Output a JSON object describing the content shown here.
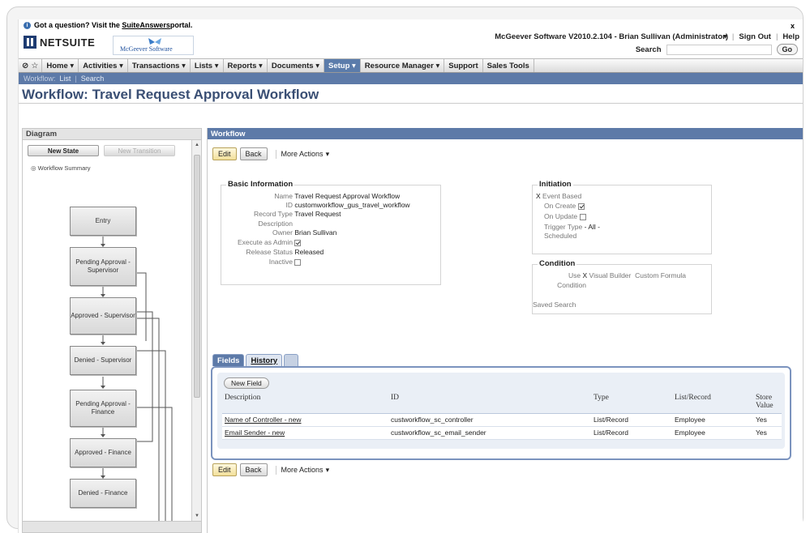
{
  "banner": {
    "question_prefix": "Got a question? Visit the ",
    "question_link": "SuiteAnswers",
    "question_suffix": " portal.",
    "close": "x"
  },
  "header": {
    "netsuite_logo": "NETSUITE",
    "company_logo_text": "McGeever Software",
    "user_info": "McGeever Software V2010.2.104 - Brian Sullivan (Administrator)",
    "sign_out": "Sign Out",
    "help": "Help",
    "search_label": "Search",
    "go": "Go"
  },
  "nav": {
    "items": [
      {
        "label": "Home"
      },
      {
        "label": "Activities"
      },
      {
        "label": "Transactions"
      },
      {
        "label": "Lists"
      },
      {
        "label": "Reports"
      },
      {
        "label": "Documents"
      },
      {
        "label": "Setup"
      },
      {
        "label": "Resource Manager"
      },
      {
        "label": "Support"
      },
      {
        "label": "Sales Tools"
      }
    ]
  },
  "subnav": {
    "prefix": "Workflow:",
    "list": "List",
    "search": "Search"
  },
  "page": {
    "title": "Workflow: Travel Request Approval Workflow"
  },
  "diagram": {
    "header": "Diagram",
    "new_state": "New State",
    "new_transition": "New Transition",
    "summary": "Workflow Summary",
    "states": [
      "Entry",
      "Pending Approval - Supervisor",
      "Approved - Supervisor",
      "Denied - Supervisor",
      "Pending Approval - Finance",
      "Approved - Finance",
      "Denied - Finance"
    ]
  },
  "workflow": {
    "header": "Workflow",
    "edit": "Edit",
    "back": "Back",
    "more_actions": "More Actions",
    "basic_info": {
      "title": "Basic Information",
      "name_label": "Name",
      "name": "Travel Request Approval Workflow",
      "id_label": "ID",
      "id": "customworkflow_gus_travel_workflow",
      "record_type_label": "Record Type",
      "record_type": "Travel Request",
      "description_label": "Description",
      "owner_label": "Owner",
      "owner": "Brian Sullivan",
      "execute_admin_label": "Execute as Admin",
      "release_status_label": "Release Status",
      "release_status": "Released",
      "inactive_label": "Inactive"
    },
    "initiation": {
      "title": "Initiation",
      "event_based": "Event Based",
      "x": "X",
      "on_create": "On Create",
      "on_update": "On Update",
      "trigger_type": "Trigger Type",
      "trigger_value": "- All -",
      "scheduled": "Scheduled"
    },
    "condition": {
      "title": "Condition",
      "use": "Use",
      "x": "X",
      "visual_builder": "Visual Builder",
      "custom_formula": "Custom Formula",
      "condition": "Condition",
      "saved_search": "Saved Search"
    },
    "tabs": {
      "fields": "Fields",
      "history": "History"
    },
    "new_field": "New Field",
    "table": {
      "headers": [
        "Description",
        "ID",
        "Type",
        "List/Record",
        "Store Value"
      ],
      "rows": [
        [
          "Name of Controller - new",
          "custworkflow_sc_controller",
          "List/Record",
          "Employee",
          "Yes"
        ],
        [
          "Email Sender - new",
          "custworkflow_sc_email_sender",
          "List/Record",
          "Employee",
          "Yes"
        ]
      ]
    }
  }
}
